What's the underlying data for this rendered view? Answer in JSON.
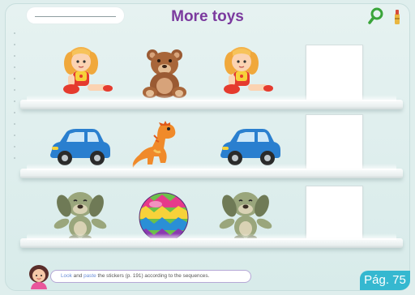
{
  "header": {
    "title": "More toys"
  },
  "icons": {
    "search": "search-icon",
    "audio": "audio-icon"
  },
  "rows": [
    {
      "items": [
        "doll",
        "teddy-bear",
        "doll"
      ],
      "answer": ""
    },
    {
      "items": [
        "car",
        "dinosaur",
        "car"
      ],
      "answer": ""
    },
    {
      "items": [
        "dog",
        "ball",
        "dog"
      ],
      "answer": ""
    }
  ],
  "footer": {
    "instruction_kw1": "Look",
    "instruction_and": " and ",
    "instruction_kw2": "paste",
    "instruction_rest": " the stickers (p. 191) according to the sequences.",
    "page_label": "Pág. 75"
  },
  "colors": {
    "title": "#7b3a9e",
    "page_badge": "#35b8d0",
    "background": "#dfeeed"
  }
}
